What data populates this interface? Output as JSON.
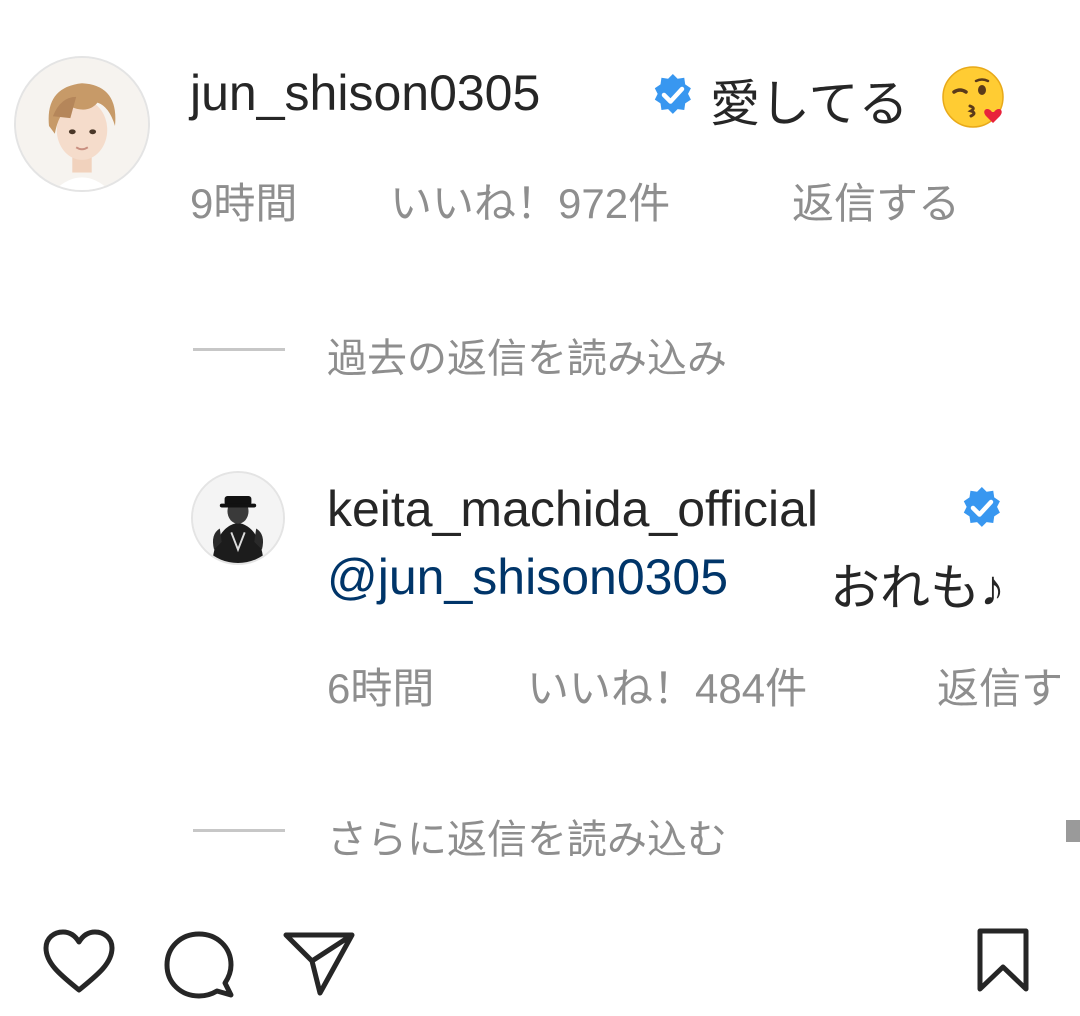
{
  "comment": {
    "username": "jun_shison0305",
    "text": "愛してる",
    "emoji": "face-throwing-kiss",
    "time": "9時間",
    "likes": "いいね！972件",
    "reply": "返信する"
  },
  "view_prev_replies": "過去の返信を読み込み",
  "reply": {
    "username": "keita_machida_official",
    "mention": "@jun_shison0305",
    "text": "おれも♪",
    "time": "6時間",
    "likes": "いいね！484件",
    "reply": "返信す"
  },
  "view_more_replies": "さらに返信を読み込む",
  "colors": {
    "text": "#262626",
    "meta": "#8e8e8e",
    "mention": "#003569",
    "verified": "#3897f0"
  },
  "action_icons": [
    "heart-icon",
    "comment-icon",
    "share-icon",
    "bookmark-icon"
  ]
}
